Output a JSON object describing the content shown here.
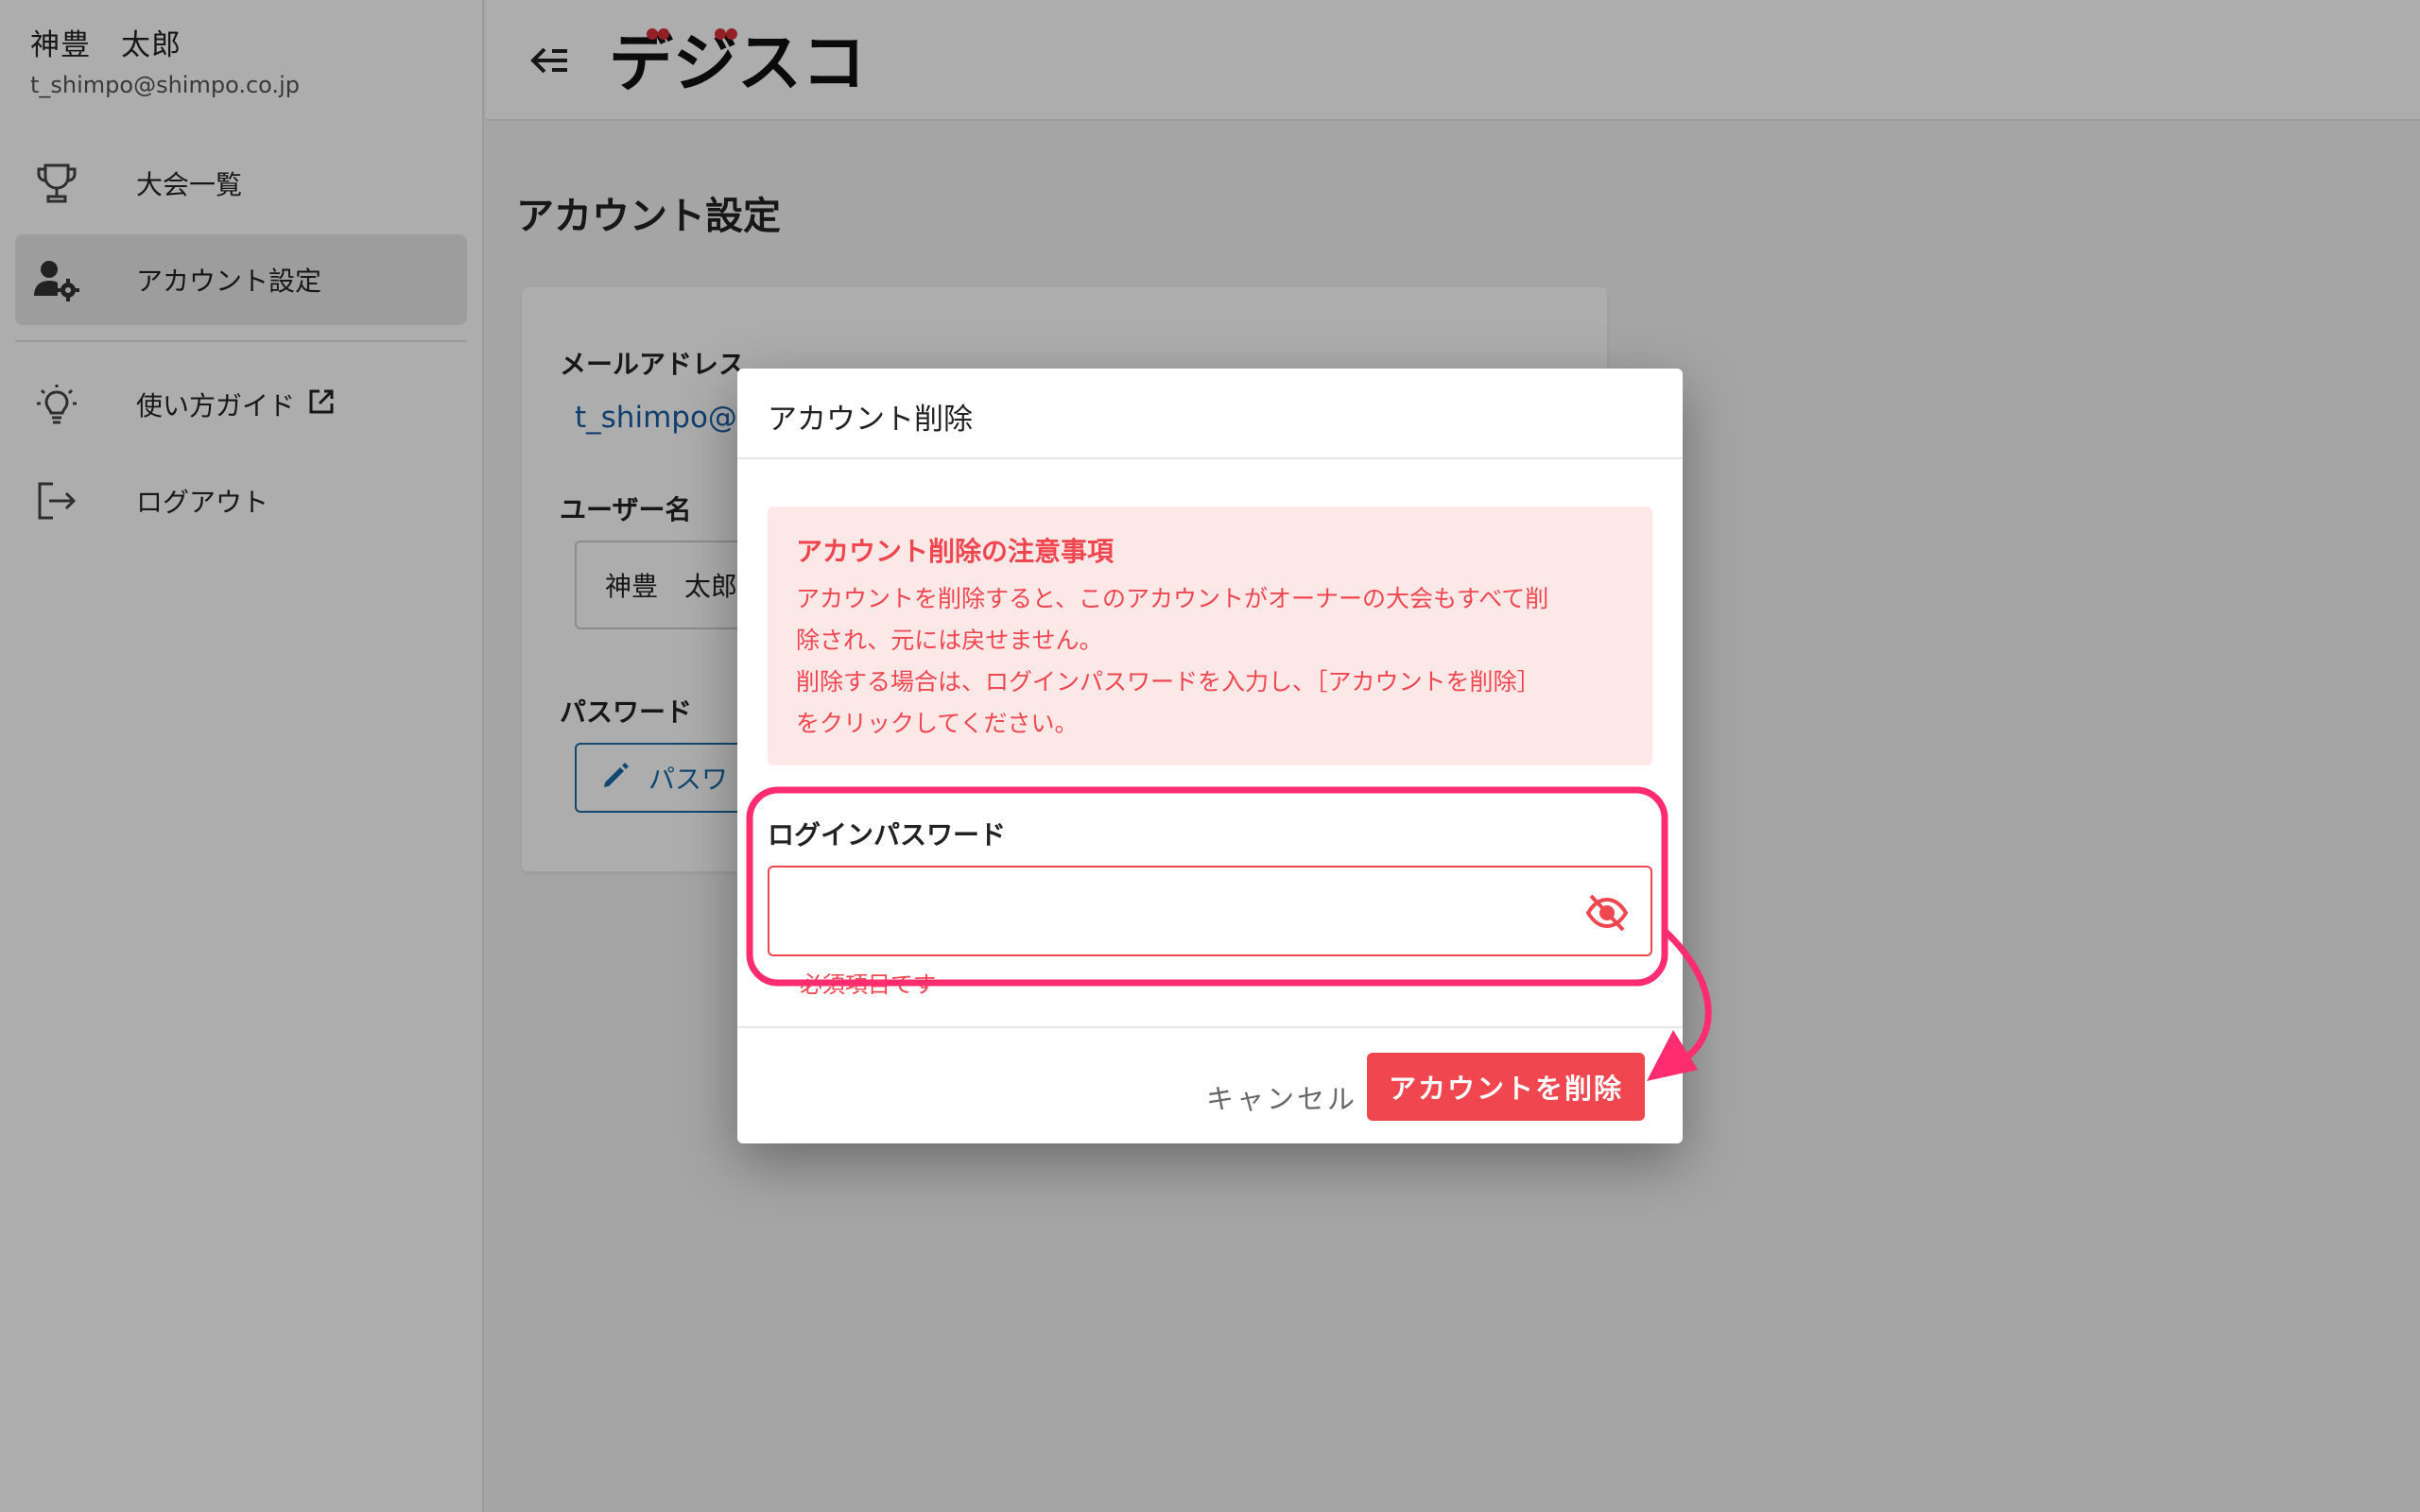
{
  "sidebar": {
    "user_name": "神豊　太郎",
    "user_email": "t_shimpo@shimpo.co.jp",
    "items": [
      {
        "label": "大会一覧",
        "icon": "trophy-icon"
      },
      {
        "label": "アカウント設定",
        "icon": "user-settings-icon",
        "active": true
      },
      {
        "label": "使い方ガイド",
        "icon": "lightbulb-icon",
        "external": true
      },
      {
        "label": "ログアウト",
        "icon": "logout-icon"
      }
    ]
  },
  "header": {
    "back_icon": "collapse-menu-icon",
    "logo_text": "デジスコ"
  },
  "main": {
    "title": "アカウント設定",
    "email_label": "メールアドレス",
    "email_value": "t_shimpo@",
    "username_label": "ユーザー名",
    "username_value": "神豊　太郎",
    "password_label": "パスワード",
    "password_button": "パスワ"
  },
  "modal": {
    "title": "アカウント削除",
    "warning_title": "アカウント削除の注意事項",
    "warning_line1": "アカウントを削除すると、このアカウントがオーナーの大会もすべて削",
    "warning_line2": "除され、元には戻せません。",
    "warning_line3": "削除する場合は、ログインパスワードを入力し、［アカウントを削除］",
    "warning_line4": "をクリックしてください。",
    "password_label": "ログインパスワード",
    "password_value": "",
    "password_error": "必須項目です",
    "cancel_label": "キャンセル",
    "delete_label": "アカウントを削除"
  },
  "colors": {
    "accent_red": "#f0464f",
    "warning_bg": "#fde8e8",
    "callout_pink": "#ff2d6f",
    "link_blue": "#1a5fa6"
  }
}
